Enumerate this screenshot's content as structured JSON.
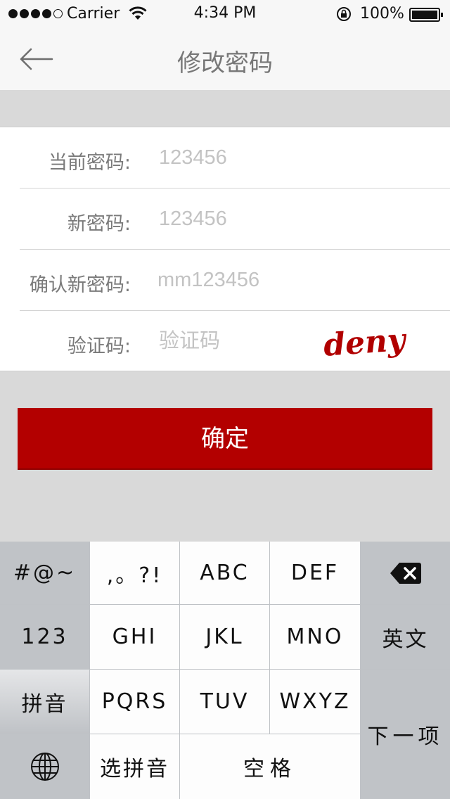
{
  "status_bar": {
    "carrier": "Carrier",
    "time": "4:34 PM",
    "battery": "100%",
    "signal_bars_filled": 4,
    "signal_bars_total": 5
  },
  "nav": {
    "back_icon": "arrow-left-icon",
    "title": "修改密码"
  },
  "form": {
    "current_password": {
      "label": "当前密码:",
      "placeholder": "123456"
    },
    "new_password": {
      "label": "新密码:",
      "placeholder": "123456"
    },
    "confirm_password": {
      "label": "确认新密码:",
      "placeholder": "mm123456"
    },
    "captcha": {
      "label": "验证码:",
      "placeholder": "验证码",
      "image_text": "deny"
    }
  },
  "confirm_button": {
    "label": "确定"
  },
  "keyboard": {
    "symbols": "#@~",
    "punct": ",。?!",
    "abc": "ABC",
    "def": "DEF",
    "backspace_icon": "backspace-icon",
    "num": "123",
    "ghi": "GHI",
    "jkl": "JKL",
    "mno": "MNO",
    "english": "英文",
    "pinyin": "拼音",
    "pqrs": "PQRS",
    "tuv": "TUV",
    "wxyz": "WXYZ",
    "next": "下一项",
    "globe_icon": "globe-icon",
    "select_pinyin": "选拼音",
    "space": "空格"
  },
  "colors": {
    "accent": "#b30000",
    "captcha_text": "#b10000",
    "background": "#d9d9d9"
  }
}
